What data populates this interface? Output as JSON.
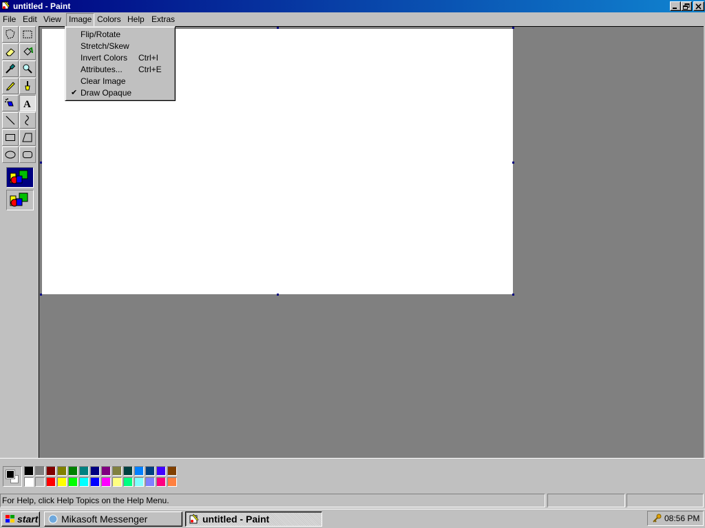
{
  "window": {
    "title": "untitled - Paint"
  },
  "menubar": {
    "items": [
      {
        "label": "File"
      },
      {
        "label": "Edit"
      },
      {
        "label": "View"
      },
      {
        "label": "Image"
      },
      {
        "label": "Colors"
      },
      {
        "label": "Help"
      },
      {
        "label": "Extras"
      }
    ],
    "open_menu": "Image"
  },
  "image_menu": {
    "items": [
      {
        "label": "Flip/Rotate",
        "shortcut": ""
      },
      {
        "label": "Stretch/Skew",
        "shortcut": ""
      },
      {
        "label": "Invert Colors",
        "shortcut": "Ctrl+I"
      },
      {
        "label": "Attributes...",
        "shortcut": "Ctrl+E"
      },
      {
        "label": "Clear Image",
        "shortcut": ""
      },
      {
        "label": "Draw Opaque",
        "shortcut": "",
        "checked": true
      }
    ],
    "check_mark": "✔"
  },
  "toolbox": {
    "tools": [
      "free-select",
      "rect-select",
      "eraser",
      "fill",
      "color-picker",
      "magnifier",
      "pencil",
      "brush",
      "airbrush",
      "text",
      "line",
      "curve",
      "rectangle",
      "polygon",
      "ellipse",
      "rounded-rectangle"
    ],
    "selected_tool": "text"
  },
  "colors": {
    "foreground": "#000000",
    "background": "#ffffff",
    "palette_top": [
      "#000000",
      "#808080",
      "#800000",
      "#808000",
      "#008000",
      "#008080",
      "#000080",
      "#800080",
      "#808040",
      "#004040",
      "#0080ff",
      "#004080",
      "#4000ff",
      "#804000"
    ],
    "palette_bottom": [
      "#ffffff",
      "#c0c0c0",
      "#ff0000",
      "#ffff00",
      "#00ff00",
      "#00ffff",
      "#0000ff",
      "#ff00ff",
      "#ffff80",
      "#00ff80",
      "#80ffff",
      "#8080ff",
      "#ff0080",
      "#ff8040"
    ]
  },
  "statusbar": {
    "help_text": "For Help, click Help Topics on the Help Menu.",
    "coords": "",
    "size": ""
  },
  "taskbar": {
    "start_label": "start",
    "tasks": [
      {
        "label": "Mikasoft Messenger",
        "active": false
      },
      {
        "label": "untitled - Paint",
        "active": true
      }
    ],
    "clock": "08:56 PM"
  }
}
